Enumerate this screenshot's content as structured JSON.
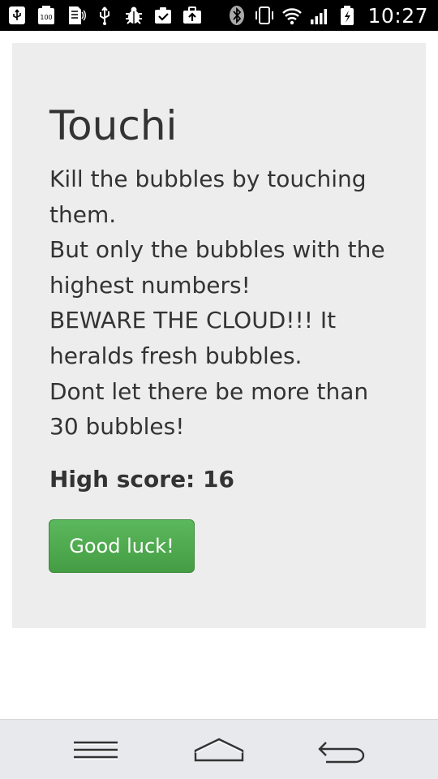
{
  "status_bar": {
    "time": "10:27",
    "left_icons": [
      "usb-icon",
      "battery-100-icon",
      "sd-card-icon",
      "usb-debug-icon",
      "bug-icon",
      "clipboard-check-icon",
      "briefcase-upload-icon"
    ],
    "right_icons": [
      "bluetooth-icon",
      "vibrate-icon",
      "wifi-icon",
      "signal-icon",
      "battery-charging-icon"
    ],
    "battery_label": "100"
  },
  "card": {
    "title": "Touchi",
    "description_lines": [
      "Kill the bubbles by touching them.",
      "But only the bubbles with the highest numbers!",
      "BEWARE THE CLOUD!!! It heralds fresh bubbles.",
      "Dont let there be more than 30 bubbles!"
    ],
    "high_score_label": "High score:",
    "high_score_value": "16",
    "start_button": "Good luck!"
  },
  "colors": {
    "card_background": "#ededed",
    "text": "#333333",
    "button": "#4cae4c",
    "status_bar": "#000000",
    "nav_bar": "#e8e9ec"
  },
  "nav_bar": {
    "buttons": [
      "menu-icon",
      "home-icon",
      "back-icon"
    ]
  }
}
